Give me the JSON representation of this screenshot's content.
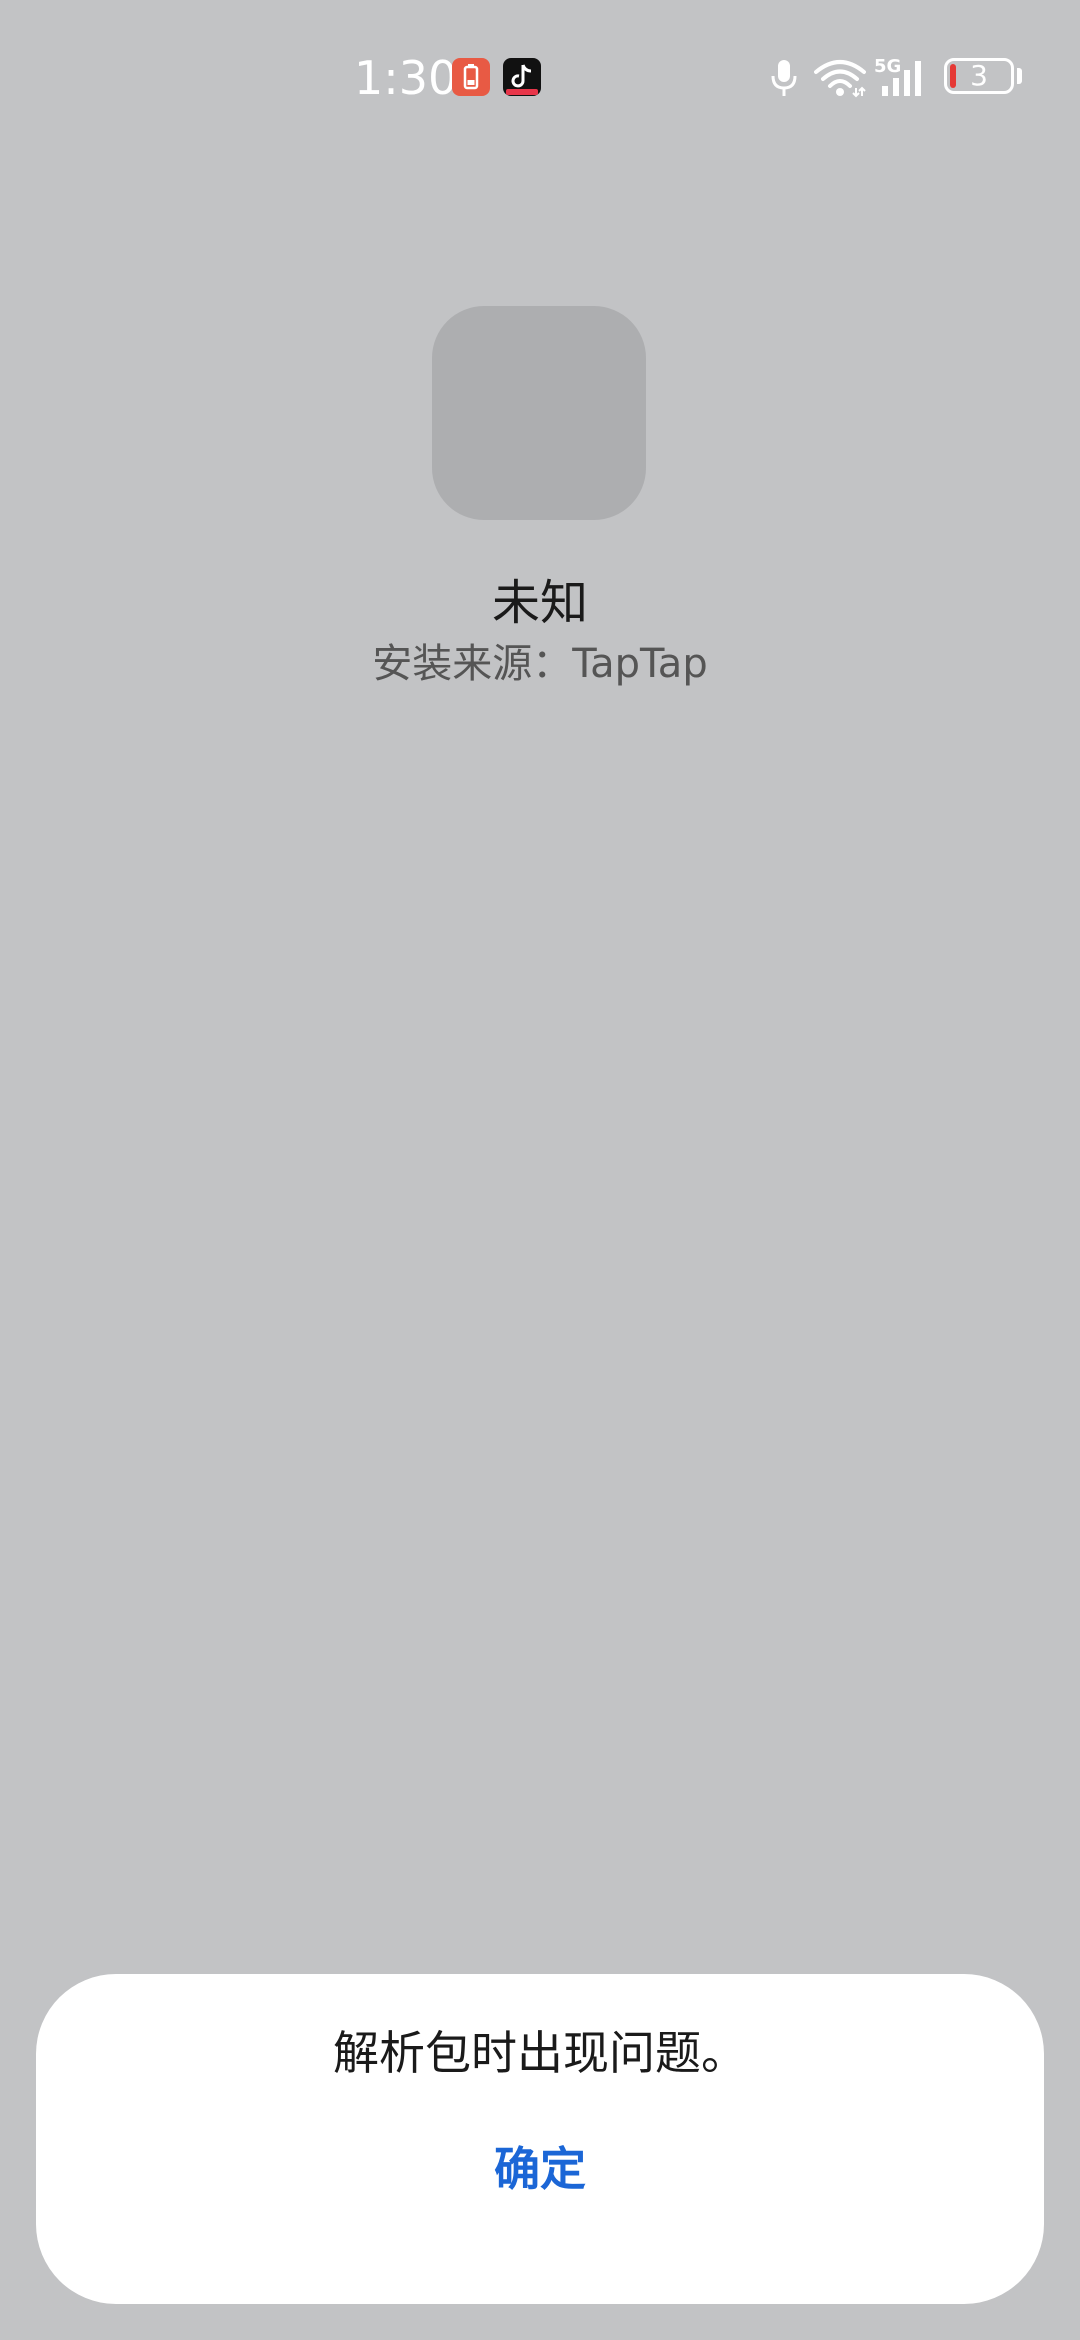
{
  "status_bar": {
    "time": "1:30",
    "network": "5G",
    "battery_level": "3",
    "battery_color": "#e53935",
    "notification_icons": [
      "battery-alert-icon",
      "tiktok-icon"
    ],
    "system_icons": [
      "microphone-icon",
      "wifi-icon",
      "cellular-signal-icon",
      "battery-icon"
    ]
  },
  "app": {
    "name": "未知",
    "install_source": "安装来源：TapTap"
  },
  "dialog": {
    "message": "解析包时出现问题。",
    "confirm_label": "确定",
    "accent_color": "#1b66d6"
  }
}
